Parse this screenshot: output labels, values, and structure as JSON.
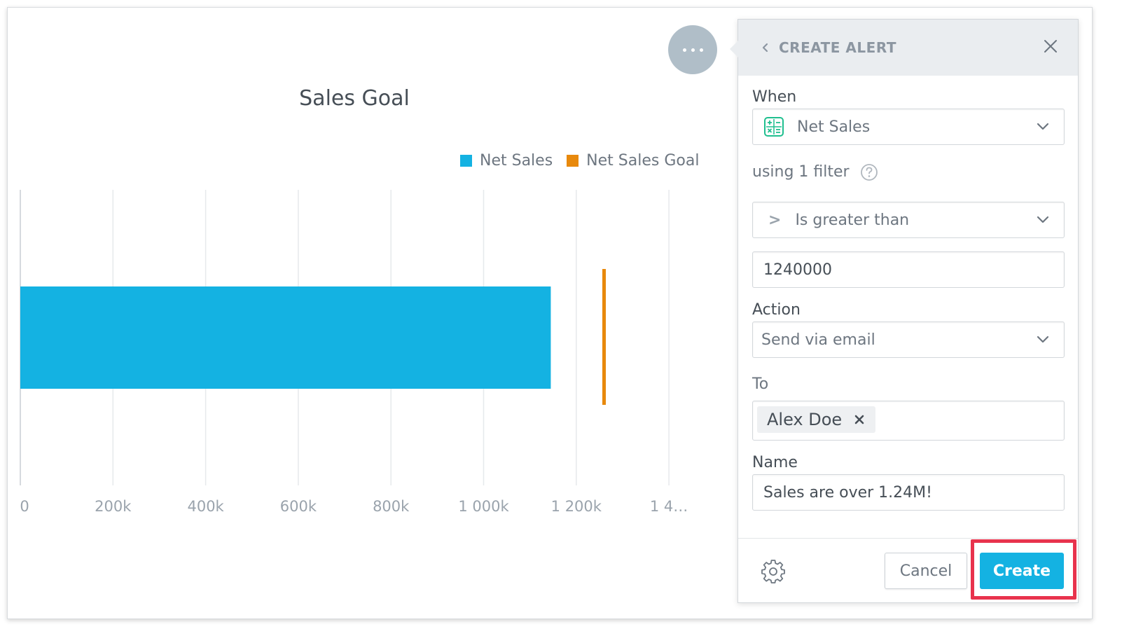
{
  "chart_data": {
    "type": "bar",
    "orientation": "horizontal",
    "title": "Sales Goal",
    "legend_placement": "top-right",
    "series": [
      {
        "name": "Net Sales",
        "color": "#14b2e2",
        "values": [
          1145000
        ]
      },
      {
        "name": "Net Sales Goal",
        "color": "#e8890c",
        "values": [
          1260000
        ],
        "mark": "goal-line"
      }
    ],
    "x_ticks": [
      "0",
      "200k",
      "400k",
      "600k",
      "800k",
      "1 000k",
      "1 200k",
      "1 4…"
    ],
    "xlim": [
      0,
      1400000
    ],
    "grid": true
  },
  "chart": {
    "more_icon": "ellipsis-icon"
  },
  "alert": {
    "title": "CREATE ALERT",
    "back_icon": "chevron-left-icon",
    "close_icon": "close-icon",
    "when_label": "When",
    "metric_icon": "calculator-icon",
    "metric_value": "Net Sales",
    "filter_text": "using 1 filter",
    "help_icon": "question-circle-icon",
    "condition_symbol": ">",
    "condition_value": "Is greater than",
    "threshold_value": "1240000",
    "action_label": "Action",
    "action_value": "Send via email",
    "to_label": "To",
    "recipient": "Alex Doe",
    "name_label": "Name",
    "name_value": "Sales are over 1.24M!",
    "settings_icon": "gear-icon",
    "cancel_label": "Cancel",
    "create_label": "Create",
    "accent_color": "#14b2e2",
    "highlight_color": "#e8334d"
  }
}
